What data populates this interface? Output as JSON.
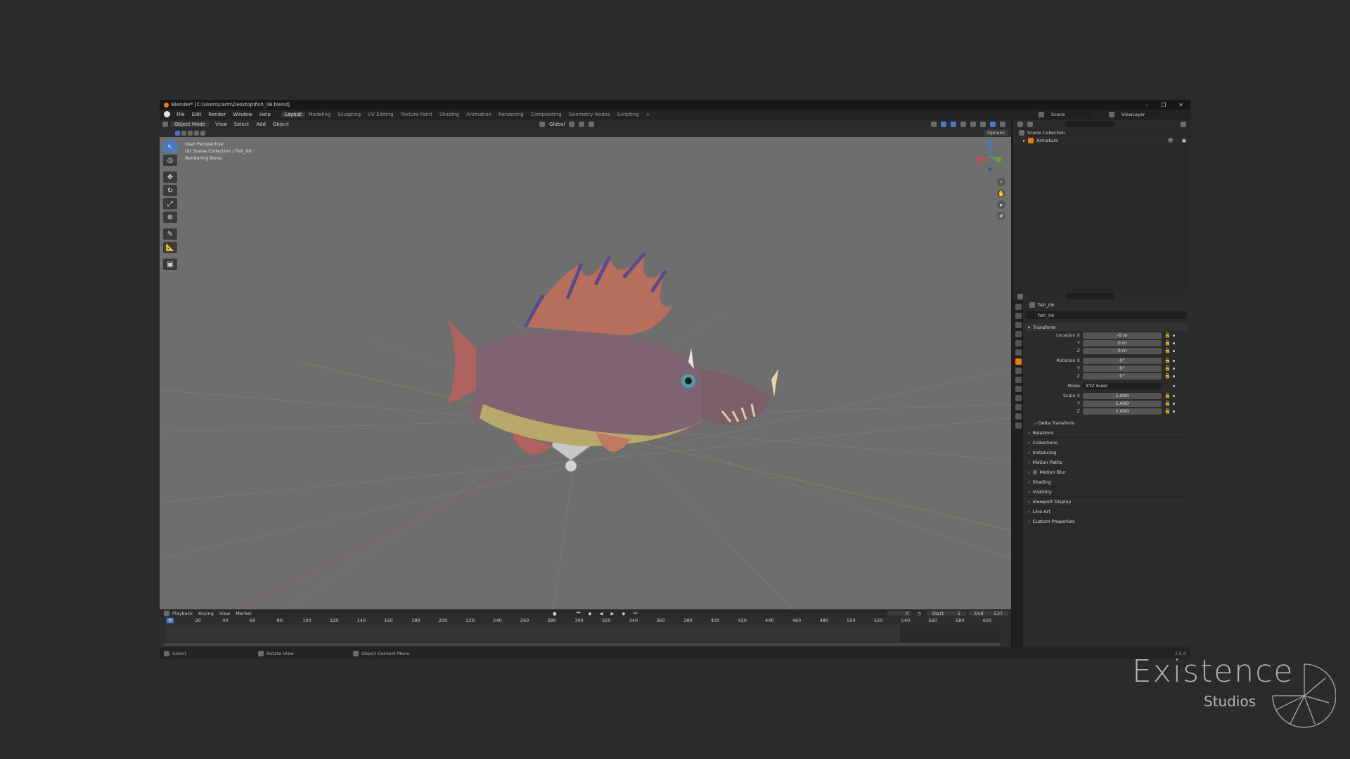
{
  "title": "Blender* [C:\\Users\\carm\\Desktop\\fish_06.blend]",
  "menus": [
    "File",
    "Edit",
    "Render",
    "Window",
    "Help"
  ],
  "workspaces": [
    "Layout",
    "Modeling",
    "Sculpting",
    "UV Editing",
    "Texture Paint",
    "Shading",
    "Animation",
    "Rendering",
    "Compositing",
    "Geometry Nodes",
    "Scripting",
    "+"
  ],
  "active_workspace": "Layout",
  "scene": {
    "scene_label": "Scene",
    "view_layer": "ViewLayer"
  },
  "viewport_header": {
    "mode": "Object Mode",
    "menus": [
      "View",
      "Select",
      "Add",
      "Object"
    ],
    "orientation": "Global",
    "options": "Options"
  },
  "viewport_info": {
    "line1": "User Perspective",
    "line2": "(0) Scene Collection | fish_06",
    "line3": "Rendering Done"
  },
  "timeline": {
    "menus": [
      "Playback",
      "Keying",
      "View",
      "Marker"
    ],
    "current_frame": "0",
    "start_label": "Start",
    "start": "1",
    "end_label": "End",
    "end": "537",
    "ruler_current": "0",
    "ticks": [
      "20",
      "40",
      "60",
      "80",
      "100",
      "120",
      "140",
      "160",
      "180",
      "200",
      "220",
      "240",
      "260",
      "280",
      "300",
      "320",
      "340",
      "360",
      "380",
      "400",
      "420",
      "440",
      "460",
      "480",
      "500",
      "520",
      "540",
      "560",
      "580",
      "600"
    ]
  },
  "statusbar": {
    "select": "Select",
    "rotate": "Rotate View",
    "context": "Object Context Menu",
    "version": "3.6.8"
  },
  "outliner": {
    "collection": "Scene Collection",
    "item": "Armature"
  },
  "properties": {
    "object_name": "fish_06",
    "object_field": "fish_06",
    "transform_label": "Transform",
    "location_label": "Location X",
    "rotation_label": "Rotation X",
    "scale_label": "Scale X",
    "y_label": "Y",
    "z_label": "Z",
    "mode_label": "Mode",
    "mode_value": "XYZ Euler",
    "location": [
      "-0 m",
      "0 m",
      "0 m"
    ],
    "rotation": [
      "0°",
      "0°",
      "0°"
    ],
    "scale": [
      "1.000",
      "1.000",
      "1.000"
    ],
    "delta": "Delta Transform",
    "sections": [
      "Relations",
      "Collections",
      "Instancing",
      "Motion Paths",
      "Motion Blur",
      "Shading",
      "Visibility",
      "Viewport Display",
      "Line Art",
      "Custom Properties"
    ]
  },
  "watermark": {
    "line1": "Existence",
    "line2": "Studios"
  },
  "colors": {
    "accent": "#4a78c2",
    "orange": "#e87d0d",
    "viewport_bg": "#6e6e6e"
  }
}
